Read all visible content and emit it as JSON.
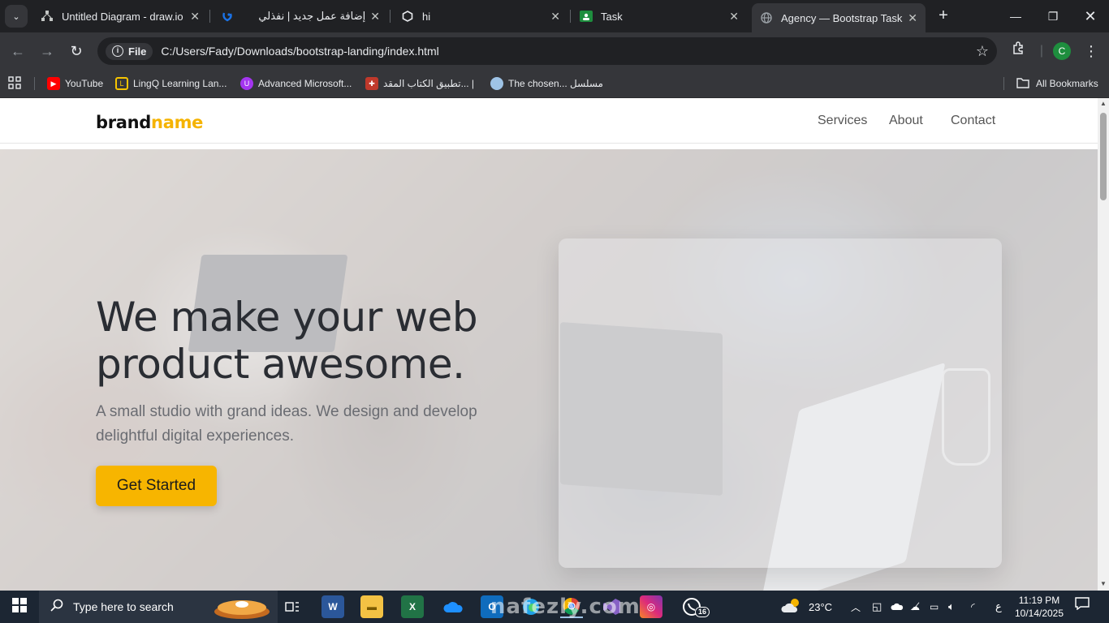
{
  "browser": {
    "tabs": [
      {
        "title": "Untitled Diagram - draw.io",
        "icon": "drawio-icon"
      },
      {
        "title": "إضافة عمل جديد | نفذلي",
        "icon": "nafezly-icon"
      },
      {
        "title": "hi",
        "icon": "github-icon"
      },
      {
        "title": "Task",
        "icon": "classroom-icon"
      },
      {
        "title": "Agency — Bootstrap Task",
        "icon": "globe-icon",
        "active": true
      }
    ],
    "address": {
      "chip": "File",
      "url": "C:/Users/Fady/Downloads/bootstrap-landing/index.html"
    },
    "profile_initial": "C",
    "bookmarks": [
      {
        "label": "YouTube",
        "icon": "youtube-icon",
        "color": "#ff0000"
      },
      {
        "label": "LingQ Learning Lan...",
        "icon": "lingq-icon",
        "color": "#f5c400"
      },
      {
        "label": "Advanced Microsoft...",
        "icon": "udemy-icon",
        "color": "#a435f0"
      },
      {
        "label": "تطبيق الكتاب المقد... |",
        "icon": "bible-icon",
        "color": "#c0392b"
      },
      {
        "label": "The chosen... مسلسل",
        "icon": "chosen-icon",
        "color": "#9ec3e6"
      }
    ],
    "all_bookmarks": "All Bookmarks"
  },
  "site": {
    "brand": {
      "main": "brand",
      "accent": "name"
    },
    "nav": [
      "Services",
      "About",
      "Contact"
    ],
    "hero": {
      "title_line1": "We make your web",
      "title_line2": "product awesome.",
      "subtitle_line1": "A small studio with grand ideas. We design and develop",
      "subtitle_line2": "delightful digital experiences.",
      "cta": "Get Started"
    },
    "colors": {
      "accent": "#f7b500"
    }
  },
  "taskbar": {
    "search_placeholder": "Type here to search",
    "weather": "23°C",
    "language": "ع",
    "time": "11:19 PM",
    "date": "10/14/2025",
    "whatsapp_badge": "16"
  },
  "watermark": "nafezly.com"
}
